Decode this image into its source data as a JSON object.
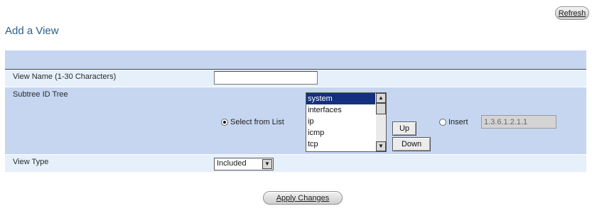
{
  "header": {
    "refresh_label": "Refresh",
    "title": "Add a View"
  },
  "form": {
    "view_name": {
      "label": "View Name (1-30 Characters)",
      "value": ""
    },
    "subtree": {
      "label": "Subtree ID Tree",
      "select_from_list_label": "Select from List",
      "select_from_list_checked": true,
      "list_options": [
        "system",
        "interfaces",
        "ip",
        "icmp",
        "tcp"
      ],
      "selected_option": "system",
      "up_label": "Up",
      "down_label": "Down",
      "insert_label": "Insert",
      "insert_checked": false,
      "insert_value": "1.3.6.1.2.1.1"
    },
    "view_type": {
      "label": "View Type",
      "value": "Included"
    }
  },
  "footer": {
    "apply_label": "Apply Changes"
  }
}
